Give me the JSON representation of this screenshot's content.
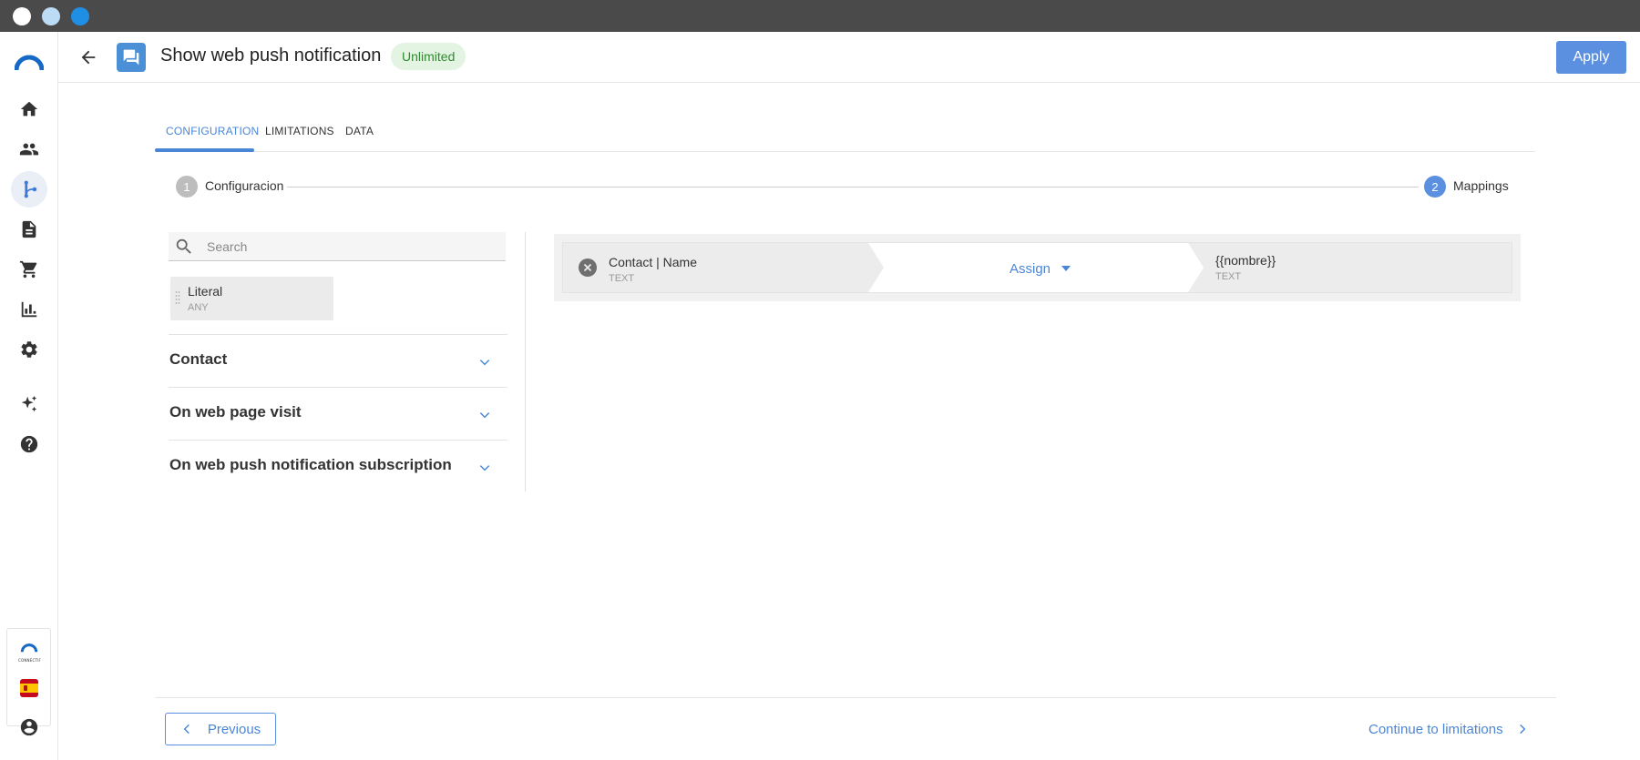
{
  "window": {
    "dots": [
      "#ffffff",
      "#bcdcf5",
      "#1f8fe6"
    ]
  },
  "sidebar": {
    "items": [
      {
        "icon": "home-icon",
        "active": false
      },
      {
        "icon": "people-icon",
        "active": false
      },
      {
        "icon": "flow-icon",
        "active": true
      },
      {
        "icon": "document-icon",
        "active": false
      },
      {
        "icon": "cart-icon",
        "active": false
      },
      {
        "icon": "bar-chart-icon",
        "active": false
      },
      {
        "icon": "gear-icon",
        "active": false
      },
      {
        "icon": "sparkle-icon",
        "active": false
      },
      {
        "icon": "help-icon",
        "active": false
      }
    ],
    "logo_small_text": "CONNECTIF",
    "language_flag": "spain-flag-icon",
    "account_icon": "account-icon"
  },
  "header": {
    "title": "Show web push notification",
    "badge": "Unlimited",
    "apply_label": "Apply"
  },
  "tabs": [
    {
      "label": "CONFIGURATION",
      "active": true
    },
    {
      "label": "LIMITATIONS",
      "active": false
    },
    {
      "label": "DATA",
      "active": false
    }
  ],
  "stepper": {
    "steps": [
      {
        "number": "1",
        "label": "Configuracion",
        "active": false
      },
      {
        "number": "2",
        "label": "Mappings",
        "active": true
      }
    ]
  },
  "fields_panel": {
    "search_placeholder": "Search",
    "literal": {
      "name": "Literal",
      "type": "ANY"
    },
    "groups": [
      {
        "title": "Contact"
      },
      {
        "title": "On web page visit"
      },
      {
        "title": "On web push notification subscription"
      }
    ]
  },
  "mapping": {
    "source_name": "Contact | Name",
    "source_type": "TEXT",
    "action_label": "Assign",
    "target_name": "{{nombre}}",
    "target_type": "TEXT"
  },
  "footer": {
    "previous_label": "Previous",
    "next_label": "Continue to limitations"
  },
  "colors": {
    "accent": "#4a86d8",
    "apply_bg": "#5b8fe0",
    "badge_bg": "#e3f4e3",
    "badge_text": "#2e8b2e",
    "step_inactive": "#bdbdbd"
  }
}
